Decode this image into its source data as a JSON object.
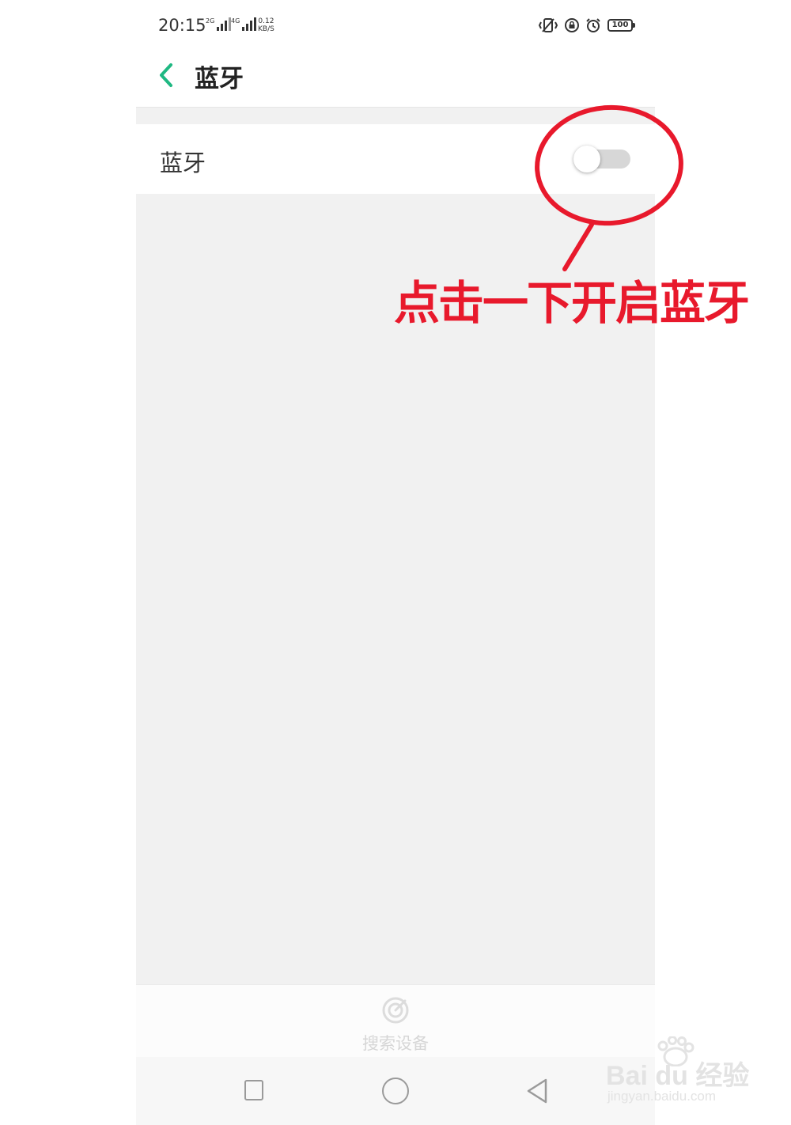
{
  "status_bar": {
    "time": "20:15",
    "signal1_tag": "2G",
    "signal2_tag": "4G",
    "net_speed_value": "0.12",
    "net_speed_unit": "KB/S",
    "battery": "100",
    "icons": [
      "vibrate-icon",
      "rotation-lock-icon",
      "alarm-icon",
      "battery-icon"
    ]
  },
  "header": {
    "title": "蓝牙",
    "back_icon": "chevron-left-icon",
    "accent_color": "#1fb882"
  },
  "bluetooth_row": {
    "label": "蓝牙",
    "toggle_on": false
  },
  "search_bar": {
    "label": "搜索设备",
    "icon": "radar-icon"
  },
  "nav_bar": {
    "icons": [
      "recents-icon",
      "home-icon",
      "back-icon"
    ]
  },
  "annotation": {
    "text": "点击一下开启蓝牙",
    "color": "#e8192c"
  },
  "watermark": {
    "brand": "Bai du 经验",
    "url": "jingyan.baidu.com"
  }
}
